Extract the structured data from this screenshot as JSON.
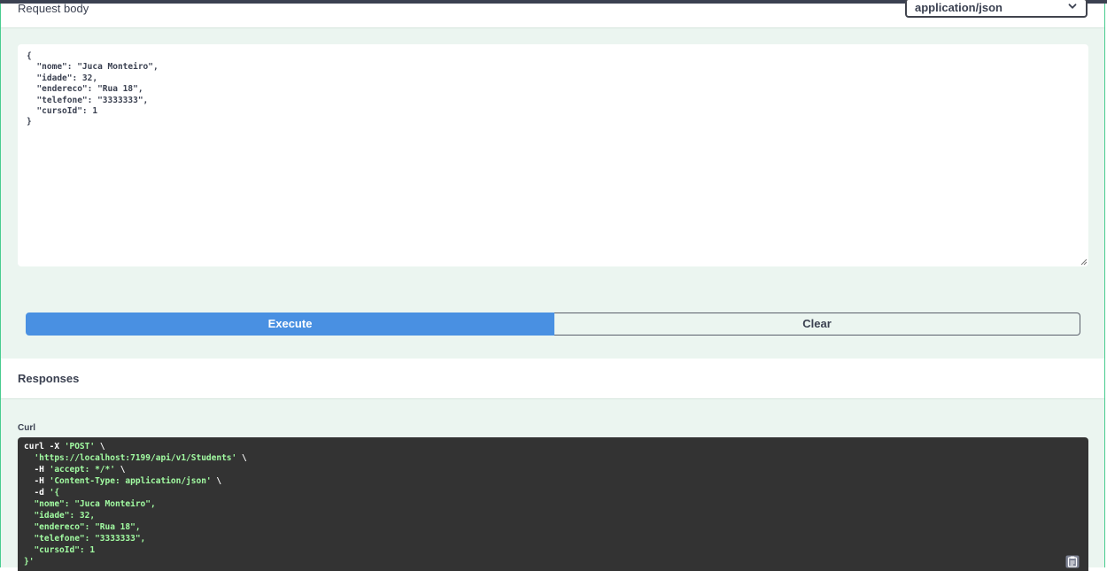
{
  "request_body": {
    "title": "Request body",
    "content_type": "application/json",
    "json_text": "{\n  \"nome\": \"Juca Monteiro\",\n  \"idade\": 32,\n  \"endereco\": \"Rua 18\",\n  \"telefone\": \"3333333\",\n  \"cursoId\": 1\n}"
  },
  "actions": {
    "execute_label": "Execute",
    "clear_label": "Clear"
  },
  "responses": {
    "title": "Responses",
    "curl_label": "Curl",
    "curl_lines": [
      {
        "prefix": "curl -X ",
        "str": "'POST'",
        "suffix": " \\"
      },
      {
        "prefix": "  ",
        "str": "'https://localhost:7199/api/v1/Students'",
        "suffix": " \\"
      },
      {
        "prefix": "  -H ",
        "str": "'accept: */*'",
        "suffix": " \\"
      },
      {
        "prefix": "  -H ",
        "str": "'Content-Type: application/json'",
        "suffix": " \\"
      },
      {
        "prefix": "  -d ",
        "str": "'{",
        "suffix": ""
      },
      {
        "prefix": "",
        "str": "  \"nome\": \"Juca Monteiro\",",
        "suffix": ""
      },
      {
        "prefix": "",
        "str": "  \"idade\": 32,",
        "suffix": ""
      },
      {
        "prefix": "",
        "str": "  \"endereco\": \"Rua 18\",",
        "suffix": ""
      },
      {
        "prefix": "",
        "str": "  \"telefone\": \"3333333\",",
        "suffix": ""
      },
      {
        "prefix": "",
        "str": "  \"cursoId\": 1",
        "suffix": ""
      },
      {
        "prefix": "",
        "str": "}'",
        "suffix": ""
      }
    ]
  },
  "colors": {
    "accent_green": "#49cc90",
    "section_bg": "#ebf5f0",
    "execute_blue": "#4990e2",
    "curl_bg": "#333333",
    "curl_string": "#a2fca2"
  },
  "icons": {
    "select": "chevron-down-icon",
    "resize": "resize-handle-icon",
    "copy": "copy-to-clipboard-icon"
  }
}
